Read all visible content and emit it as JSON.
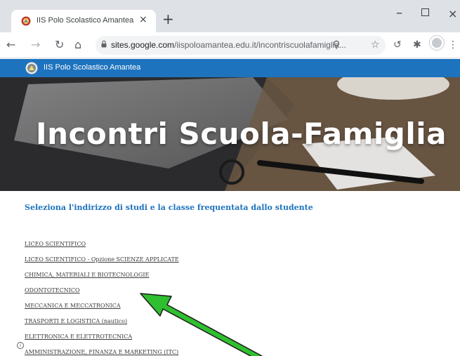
{
  "browser": {
    "tab_title": "IIS Polo Scolastico Amantea",
    "tab_close": "×",
    "new_tab": "+",
    "url_domain": "sites.google.com",
    "url_path": "/iispoloamantea.edu.it/incontriscuolafamiglia...",
    "win_min": "–",
    "win_close": "×"
  },
  "site": {
    "name": "IIS Polo Scolastico Amantea",
    "hero_title": "Incontri Scuola-Famiglia",
    "heading": "Seleziona l'indirizzo di studi e la classe frequentata dallo studente",
    "links": [
      "LICEO SCIENTIFICO",
      "LICEO SCIENTIFICO - Opzione SCIENZE APPLICATE",
      "CHIMICA, MATERIALI E BIOTECNOLOGIE",
      "ODONTOTECNICO",
      "MECCANICA E MECCATRONICA",
      "TRASPORTI E LOGISTICA (nautico)",
      "ELETTRONICA E ELETTROTECNICA",
      "AMMINISTRAZIONE, FINANZA E MARKETING (ITC)"
    ],
    "info": "i"
  },
  "colors": {
    "header_blue": "#1e73be",
    "arrow_green": "#2fbf2f"
  }
}
